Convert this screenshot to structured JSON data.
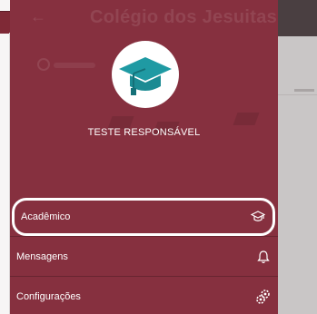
{
  "app": {
    "title": "Colégio dos Jesuitas"
  },
  "profile": {
    "avatar_icon": "graduation-cap-icon",
    "name": "TESTE RESPONSÁVEL"
  },
  "menu": {
    "items": [
      {
        "label": "Acadêmico",
        "icon": "graduation-cap-outline-icon",
        "selected": true
      },
      {
        "label": "Mensagens",
        "icon": "bell-icon",
        "selected": false
      },
      {
        "label": "Configurações",
        "icon": "gears-icon",
        "selected": false
      }
    ]
  },
  "colors": {
    "drawer_background": "#86303f",
    "avatar_cap": "#1f9aa3",
    "highlight_border": "#ffffff",
    "overlay_background": "#c9c6c6"
  }
}
